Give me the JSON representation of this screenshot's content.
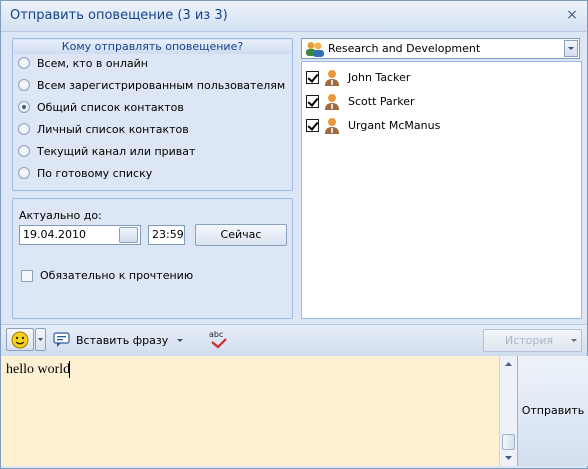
{
  "window": {
    "title": "Отправить оповещение (3 из 3)",
    "close_glyph": "×"
  },
  "recipients": {
    "group_title": "Кому отправлять оповещение?",
    "options": [
      {
        "label": "Всем, кто в онлайн",
        "selected": false
      },
      {
        "label": "Всем зарегистрированным пользователям",
        "selected": false
      },
      {
        "label": "Общий список контактов",
        "selected": true
      },
      {
        "label": "Личный список контактов",
        "selected": false
      },
      {
        "label": "Текущий канал или приват",
        "selected": false
      },
      {
        "label": "По готовому списку",
        "selected": false
      }
    ]
  },
  "validity": {
    "label": "Актуально до:",
    "date": "19.04.2010",
    "time": "23:59",
    "now_button": "Сейчас",
    "mandatory_label": "Обязательно к прочтению",
    "mandatory_checked": false
  },
  "group_select": {
    "selected": "Research and Development"
  },
  "contacts": [
    {
      "name": "John Tacker",
      "checked": true
    },
    {
      "name": "Scott Parker",
      "checked": true
    },
    {
      "name": "Urgant McManus",
      "checked": true
    }
  ],
  "toolbar": {
    "insert_phrase": "Вставить фразу",
    "spell_icon_text": "abc",
    "history": "История"
  },
  "message": {
    "text": "hello world"
  },
  "send_button": "Отправить",
  "colors": {
    "accent": "#15428b",
    "message_bg": "#fdf0d3",
    "panel_bg": "#dce6f4"
  }
}
